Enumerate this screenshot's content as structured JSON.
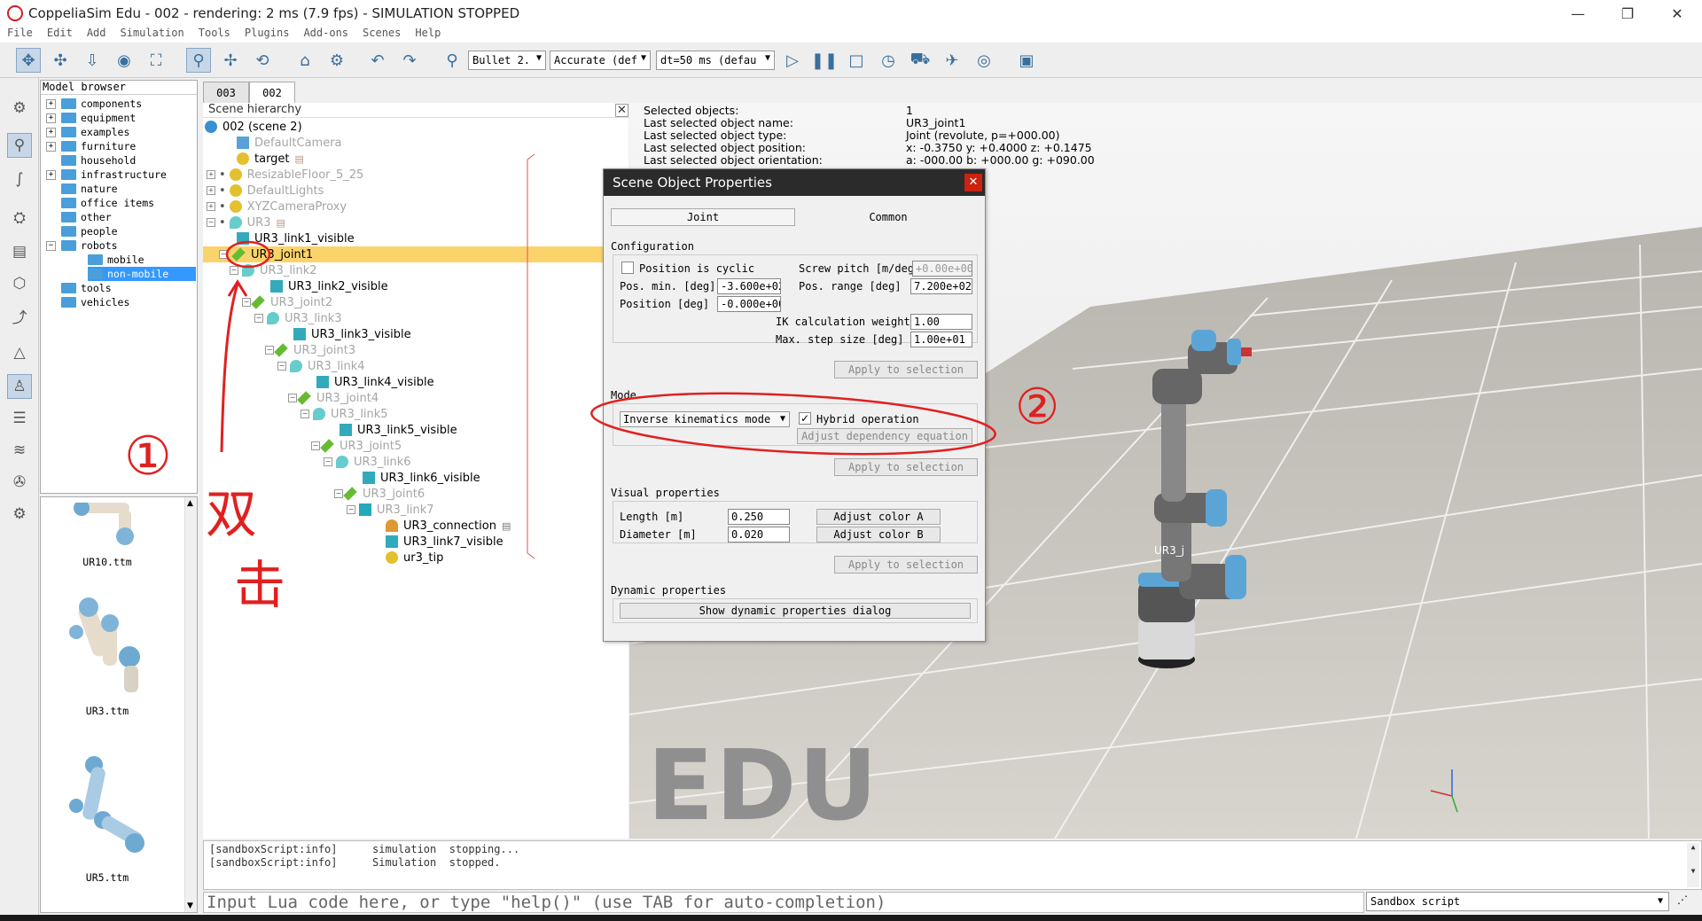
{
  "window": {
    "title": "CoppeliaSim Edu - 002 - rendering: 2 ms (7.9 fps) - SIMULATION STOPPED",
    "controls": [
      "—",
      "❐",
      "✕"
    ]
  },
  "menu": [
    "File",
    "Edit",
    "Add",
    "Simulation",
    "Tools",
    "Plugins",
    "Add-ons",
    "Scenes",
    "Help"
  ],
  "toolbar": {
    "engine": "Bullet 2.",
    "accuracy": "Accurate (def",
    "timestep": "dt=50 ms (defau"
  },
  "model_browser": {
    "header": "Model browser",
    "items": [
      {
        "label": "components",
        "expandable": true
      },
      {
        "label": "equipment",
        "expandable": true
      },
      {
        "label": "examples",
        "expandable": true
      },
      {
        "label": "furniture",
        "expandable": true
      },
      {
        "label": "household",
        "expandable": true
      },
      {
        "label": "infrastructure",
        "expandable": true
      },
      {
        "label": "nature",
        "expandable": false
      },
      {
        "label": "office items",
        "expandable": false
      },
      {
        "label": "other",
        "expandable": false
      },
      {
        "label": "people",
        "expandable": false
      },
      {
        "label": "robots",
        "expandable": true
      },
      {
        "label": "mobile",
        "expandable": false
      },
      {
        "label": "non-mobile",
        "expandable": false
      },
      {
        "label": "tools",
        "expandable": false
      },
      {
        "label": "vehicles",
        "expandable": false
      }
    ],
    "thumbnails": [
      "UR10.ttm",
      "UR3.ttm",
      "UR5.ttm"
    ]
  },
  "scene_tabs": [
    "003",
    "002"
  ],
  "hierarchy": {
    "header": "Scene hierarchy",
    "rows": [
      {
        "label": "002 (scene 2)",
        "dim": false
      },
      {
        "label": "DefaultCamera",
        "dim": true
      },
      {
        "label": "target",
        "dim": false
      },
      {
        "label": "ResizableFloor_5_25",
        "dim": true
      },
      {
        "label": "DefaultLights",
        "dim": true
      },
      {
        "label": "XYZCameraProxy",
        "dim": true
      },
      {
        "label": "UR3",
        "dim": true
      },
      {
        "label": "UR3_link1_visible",
        "dim": false
      },
      {
        "label": "UR3_joint1",
        "dim": false,
        "selected": true
      },
      {
        "label": "UR3_link2",
        "dim": true
      },
      {
        "label": "UR3_link2_visible",
        "dim": false
      },
      {
        "label": "UR3_joint2",
        "dim": true
      },
      {
        "label": "UR3_link3",
        "dim": true
      },
      {
        "label": "UR3_link3_visible",
        "dim": false
      },
      {
        "label": "UR3_joint3",
        "dim": true
      },
      {
        "label": "UR3_link4",
        "dim": true
      },
      {
        "label": "UR3_link4_visible",
        "dim": false
      },
      {
        "label": "UR3_joint4",
        "dim": true
      },
      {
        "label": "UR3_link5",
        "dim": true
      },
      {
        "label": "UR3_link5_visible",
        "dim": false
      },
      {
        "label": "UR3_joint5",
        "dim": true
      },
      {
        "label": "UR3_link6",
        "dim": true
      },
      {
        "label": "UR3_link6_visible",
        "dim": false
      },
      {
        "label": "UR3_joint6",
        "dim": true
      },
      {
        "label": "UR3_link7",
        "dim": true
      },
      {
        "label": "UR3_connection",
        "dim": false
      },
      {
        "label": "UR3_link7_visible",
        "dim": false
      },
      {
        "label": "ur3_tip",
        "dim": false
      }
    ]
  },
  "selection_info": {
    "rows": [
      {
        "k": "Selected objects:",
        "v": "1"
      },
      {
        "k": "Last selected object name:",
        "v": "UR3_joint1"
      },
      {
        "k": "Last selected object type:",
        "v": "Joint (revolute, p=+000.00)"
      },
      {
        "k": "Last selected object position:",
        "v": "x: -0.3750    y: +0.4000    z: +0.1475"
      },
      {
        "k": "Last selected object orientation:",
        "v": "a: -000.00    b: +000.00    g: +090.00"
      }
    ]
  },
  "dialog": {
    "title": "Scene Object Properties",
    "tab_joint": "Joint",
    "tab_common": "Common",
    "configuration": "Configuration",
    "position_cyclic": "Position is cyclic",
    "screw_pitch_label": "Screw pitch [m/deg]",
    "screw_pitch": "+0.00e+00",
    "pos_min_label": "Pos. min. [deg]",
    "pos_min": "-3.600e+02",
    "pos_range_label": "Pos. range [deg]",
    "pos_range": "7.200e+02",
    "position_label": "Position [deg]",
    "position": "-0.000e+00",
    "ik_weight_label": "IK calculation weight",
    "ik_weight": "1.00",
    "max_step_label": "Max. step size [deg]",
    "max_step": "1.00e+01",
    "apply": "Apply to selection",
    "mode": "Mode",
    "mode_value": "Inverse kinematics mode",
    "hybrid": "Hybrid operation",
    "hybrid_checked": "✓",
    "adjust_dep": "Adjust dependency equation",
    "visual": "Visual properties",
    "length_label": "Length [m]",
    "length": "0.250",
    "diameter_label": "Diameter [m]",
    "diameter": "0.020",
    "color_a": "Adjust color A",
    "color_b": "Adjust color B",
    "dynamic": "Dynamic properties",
    "show_dynamic": "Show dynamic properties dialog"
  },
  "viewport": {
    "watermark": "EDU",
    "robot_label": "UR3_j"
  },
  "console": {
    "lines": [
      {
        "src": "[sandboxScript:info]",
        "msg": "simulation  stopping..."
      },
      {
        "src": "[sandboxScript:info]",
        "msg": "Simulation  stopped."
      }
    ]
  },
  "lua_input": {
    "placeholder": "Input Lua code here, or type \"help()\" (use TAB for auto-completion)"
  },
  "sandbox": "Sandbox script",
  "annotations": {
    "one": "①",
    "two": "②",
    "double": "双",
    "click": "击"
  },
  "colors": {
    "selected_row": "#fbd36b",
    "accent": "#3399ff",
    "annotation": "#e02020"
  }
}
